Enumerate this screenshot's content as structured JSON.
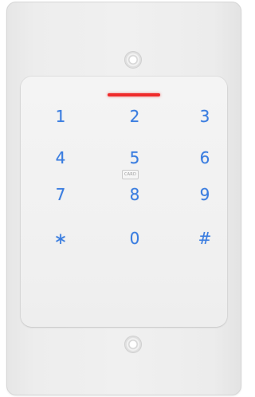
{
  "keypad": {
    "keys": [
      "1",
      "2",
      "3",
      "4",
      "5",
      "6",
      "7",
      "8",
      "9",
      "∗",
      "0",
      "#"
    ],
    "card_logo": "CARD"
  },
  "colors": {
    "key_digit": "#3a7de0",
    "status_led": "#ef2a2a",
    "plate": "#efefef"
  }
}
